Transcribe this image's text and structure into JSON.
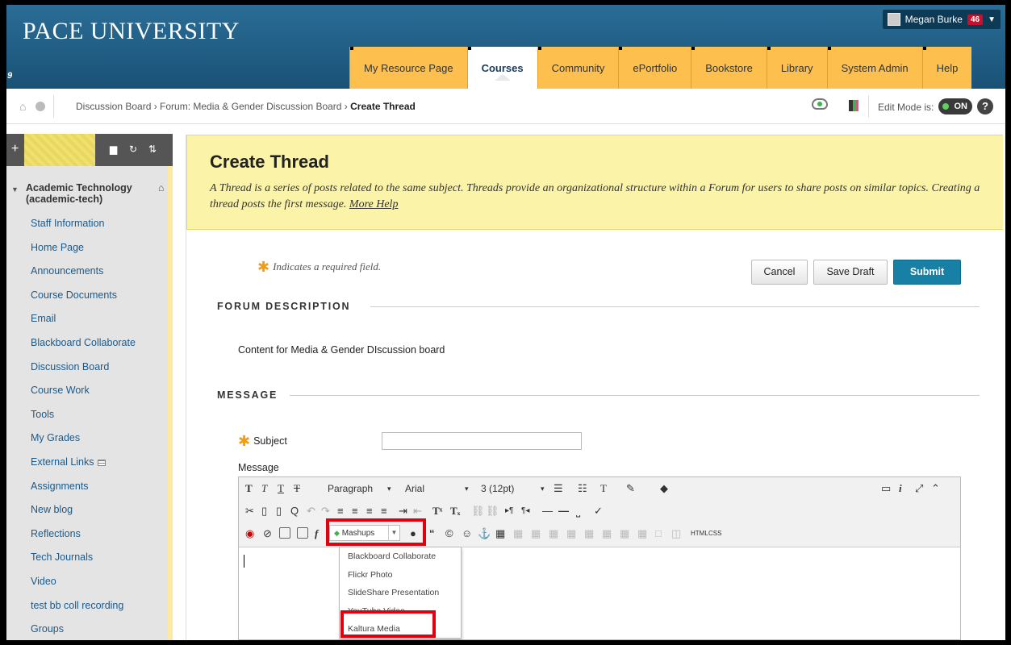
{
  "header": {
    "logo": "PACE UNIVERSITY",
    "user_name": "Megan Burke",
    "user_badge": "46",
    "corner_digit": "9",
    "tabs": [
      {
        "label": "My Resource Page"
      },
      {
        "label": "Courses"
      },
      {
        "label": "Community"
      },
      {
        "label": "ePortfolio"
      },
      {
        "label": "Bookstore"
      },
      {
        "label": "Library"
      },
      {
        "label": "System Admin"
      },
      {
        "label": "Help"
      }
    ]
  },
  "breadcrumb": {
    "path": "Discussion Board › Forum: Media & Gender Discussion Board › ",
    "current": "Create Thread",
    "edit_mode_label": "Edit Mode is:",
    "edit_mode_value": "ON"
  },
  "sidebar": {
    "course_name": "Academic Technology (academic-tech)",
    "items": [
      {
        "label": "Staff Information"
      },
      {
        "label": "Home Page"
      },
      {
        "label": "Announcements"
      },
      {
        "label": "Course Documents"
      },
      {
        "label": "Email"
      },
      {
        "label": "Blackboard Collaborate"
      },
      {
        "label": "Discussion Board"
      },
      {
        "label": "Course Work"
      },
      {
        "label": "Tools"
      },
      {
        "label": "My Grades"
      },
      {
        "label": "External Links"
      },
      {
        "label": "Assignments"
      },
      {
        "label": "New blog"
      },
      {
        "label": "Reflections"
      },
      {
        "label": "Tech Journals"
      },
      {
        "label": "Video"
      },
      {
        "label": "test bb coll recording"
      },
      {
        "label": "Groups"
      }
    ]
  },
  "page": {
    "title": "Create Thread",
    "intro": "A Thread is a series of posts related to the same subject. Threads provide an organizational structure within a Forum for users to share posts on similar topics. Creating a thread posts the first message.",
    "more_help": "More Help",
    "required_note": "Indicates a required field.",
    "cancel": "Cancel",
    "save_draft": "Save Draft",
    "submit": "Submit",
    "forum_description_heading": "FORUM DESCRIPTION",
    "forum_description": "Content for Media & Gender DIscussion board",
    "message_heading": "MESSAGE",
    "subject_label": "Subject",
    "subject_value": "",
    "message_label": "Message"
  },
  "editor": {
    "format_select": "Paragraph",
    "font_select": "Arial",
    "size_select": "3 (12pt)",
    "mashups_label": "Mashups",
    "html_label": "HTML",
    "css_label": "CSS",
    "mashup_options": [
      {
        "label": "Blackboard Collaborate"
      },
      {
        "label": "Flickr Photo"
      },
      {
        "label": "SlideShare Presentation"
      },
      {
        "label": "YouTube Video"
      },
      {
        "label": "Kaltura Media"
      }
    ]
  },
  "colors": {
    "header_blue": "#1f5b82",
    "tab_gold": "#fdc04f",
    "submit_blue": "#187fa5",
    "highlight_red": "#e00010",
    "intro_yellow": "#fbf3a8"
  }
}
